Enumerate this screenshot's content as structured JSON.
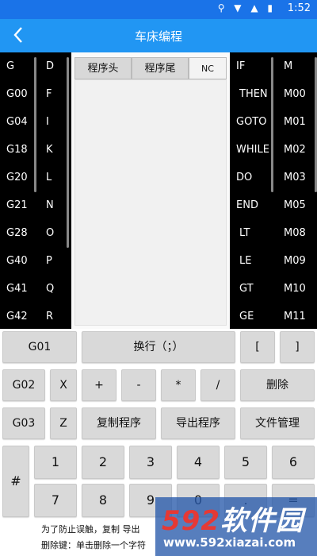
{
  "status_bar": {
    "time": "1:52",
    "icons": "⚲ ▼ ▲ ▮"
  },
  "header": {
    "title": "车床编程",
    "back_icon": "chevron-left-icon"
  },
  "left_panel": {
    "col1": [
      "G",
      "G00",
      "G04",
      "G18",
      "G20",
      "G21",
      "G28",
      "G40",
      "G41",
      "G42"
    ],
    "col2": [
      "D",
      "F",
      "I",
      "K",
      "L",
      "N",
      "O",
      "P",
      "Q",
      "R"
    ]
  },
  "right_panel": {
    "col1": [
      "IF",
      "THEN",
      "GOTO",
      "WHILE",
      "DO",
      "END",
      "LT",
      "LE",
      "GT",
      "GE"
    ],
    "col2": [
      "M",
      "M00",
      "M01",
      "M02",
      "M03",
      "M05",
      "M08",
      "M09",
      "M10",
      "M11"
    ]
  },
  "tabs": [
    "程序头",
    "程序尾",
    "NC"
  ],
  "keypad": {
    "row1": [
      "G01",
      "换行（；）",
      "[",
      "]"
    ],
    "row2": [
      "G02",
      "X",
      "+",
      "-",
      "*",
      "/",
      "删除"
    ],
    "row3": [
      "G03",
      "Z",
      "复制程序",
      "导出程序",
      "文件管理"
    ],
    "hash": "#",
    "digits_top": [
      "1",
      "2",
      "3",
      "4",
      "5",
      "6"
    ],
    "digits_bottom": [
      "7",
      "8",
      "9",
      "0",
      ".",
      "="
    ]
  },
  "footer": {
    "line1": "为了防止误触，复制 导出",
    "line2": "删除键：单击删除一个字符"
  },
  "watermark": {
    "num": "592",
    "text": "软件园",
    "url": "www.592xiazai.com"
  }
}
